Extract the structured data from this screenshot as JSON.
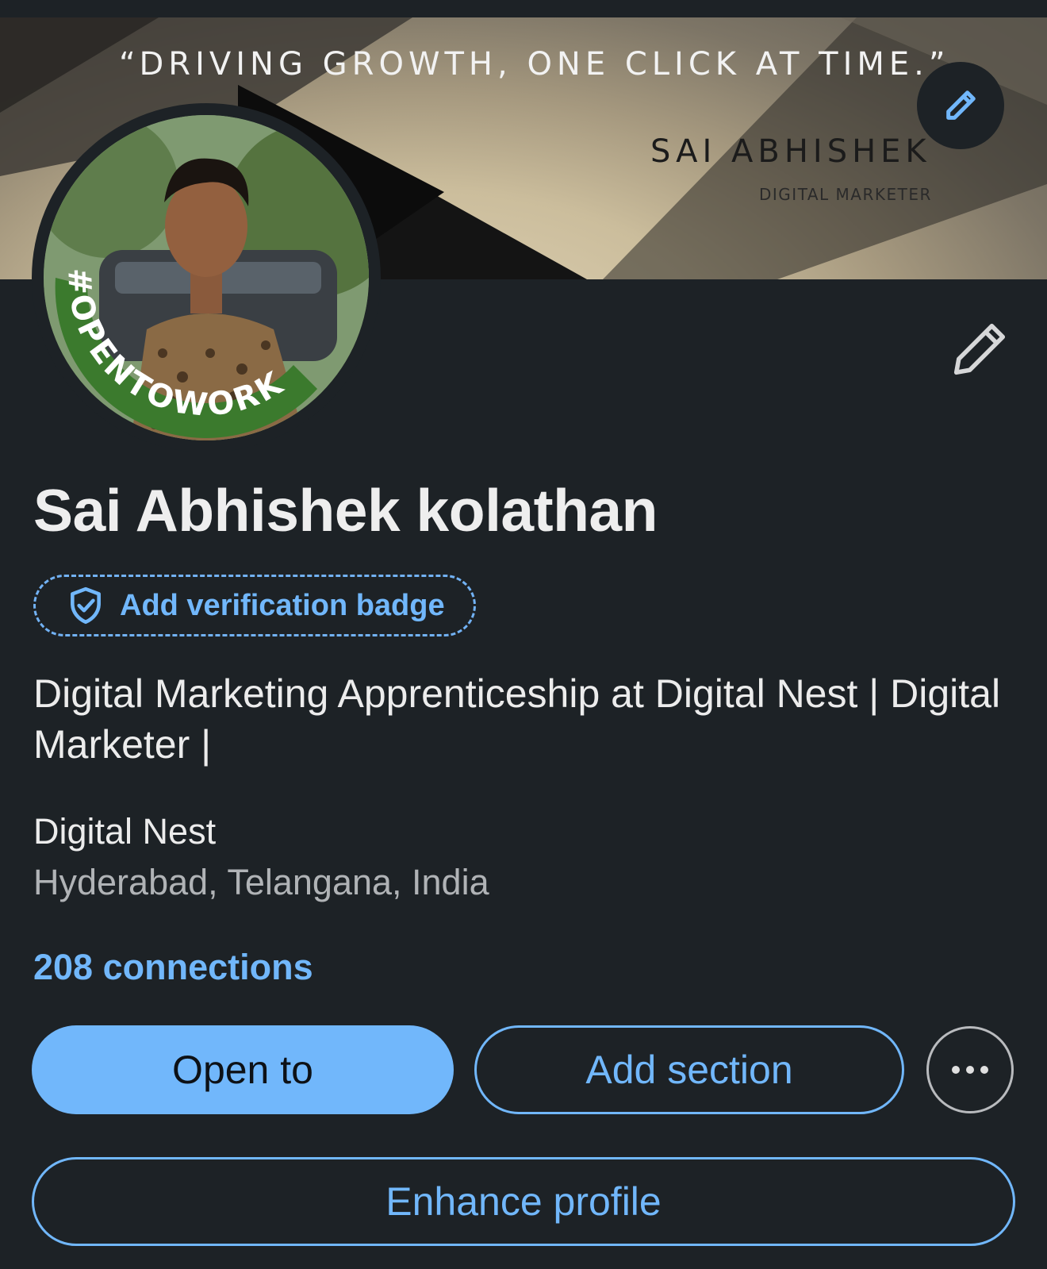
{
  "banner": {
    "quote": "“DRIVING GROWTH, ONE CLICK AT TIME.”",
    "name": "SAI ABHISHEK",
    "title": "DIGITAL MARKETER"
  },
  "avatar": {
    "frame_text": "#OPENTOWORK",
    "frame_color": "#3b7a2d"
  },
  "profile": {
    "name": "Sai Abhishek kolathan",
    "verification_label": "Add verification badge",
    "headline": "Digital Marketing Apprenticeship at Digital Nest | Digital Marketer |",
    "company": "Digital Nest",
    "location": "Hyderabad, Telangana, India",
    "connections": "208 connections"
  },
  "actions": {
    "open_to": "Open to",
    "add_section": "Add section",
    "enhance_profile": "Enhance profile"
  },
  "colors": {
    "background": "#1d2226",
    "accent": "#71b7fb",
    "text": "#ececec",
    "muted": "#b0b3b6"
  },
  "icons": {
    "cover_edit": "pencil-icon",
    "profile_edit": "pencil-icon",
    "verify": "shield-check-icon",
    "more": "ellipsis-icon"
  }
}
